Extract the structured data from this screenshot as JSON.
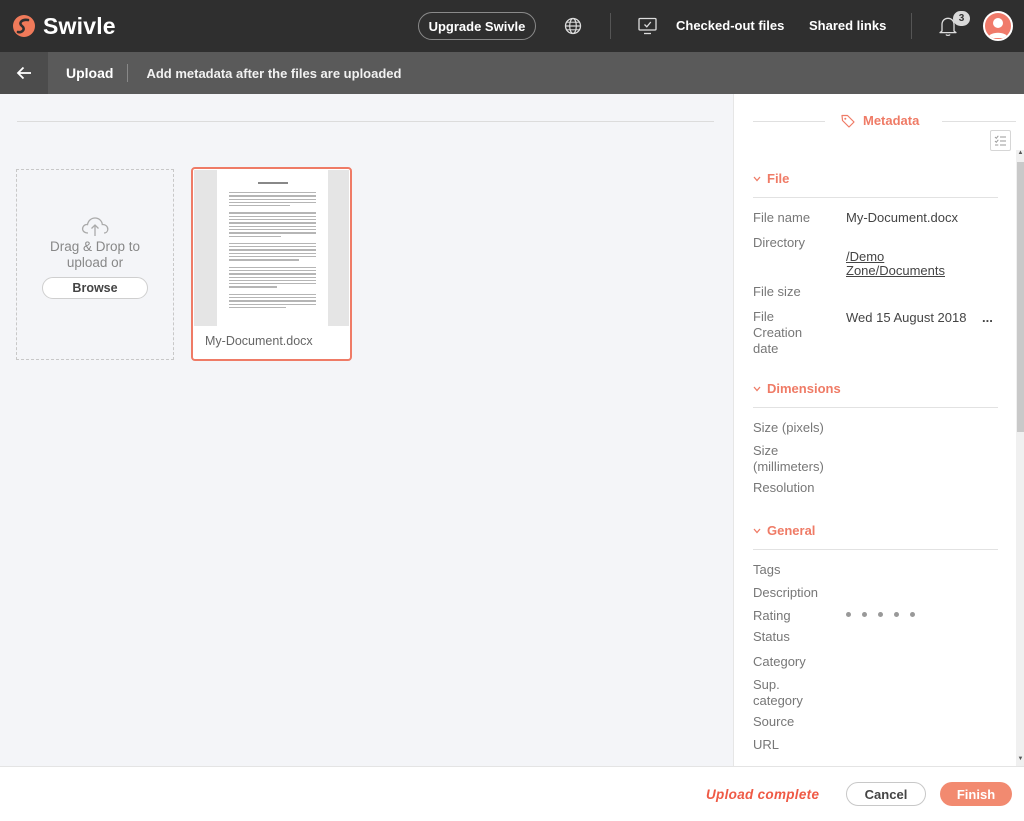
{
  "app": {
    "name": "Swivle"
  },
  "topbar": {
    "upgrade_label": "Upgrade Swivle",
    "checked_out_label": "Checked-out files",
    "shared_links_label": "Shared links",
    "notification_count": "3"
  },
  "subbar": {
    "title": "Upload",
    "description": "Add metadata after the files are uploaded"
  },
  "dropzone": {
    "text": "Drag & Drop to upload or",
    "browse_label": "Browse"
  },
  "file": {
    "name": "My-Document.docx"
  },
  "panel": {
    "heading": "Metadata",
    "sections": {
      "file": {
        "title": "File",
        "file_name_label": "File name",
        "file_name_value": "My-Document.docx",
        "directory_label": "Directory",
        "directory_value_1": "/Demo ",
        "directory_value_2": "Zone/Documents",
        "file_size_label": "File size",
        "creation_label_1": "File",
        "creation_label_2": "Creation",
        "creation_label_3": "date",
        "creation_value": "Wed 15 August 2018",
        "creation_more": "..."
      },
      "dimensions": {
        "title": "Dimensions",
        "size_px_label": "Size (pixels)",
        "size_mm_label_1": "Size",
        "size_mm_label_2": "(millimeters)",
        "resolution_label": "Resolution"
      },
      "general": {
        "title": "General",
        "tags_label": "Tags",
        "description_label": "Description",
        "rating_label": "Rating",
        "rating_value": 0,
        "rating_max": 5,
        "status_label": "Status",
        "category_label": "Category",
        "sup_category_label_1": "Sup.",
        "sup_category_label_2": "category",
        "source_label": "Source",
        "url_label": "URL"
      }
    }
  },
  "footer": {
    "status": "Upload complete",
    "cancel_label": "Cancel",
    "finish_label": "Finish"
  },
  "colors": {
    "accent": "#ef7b66",
    "topbar": "#2f2f2f",
    "subbar": "#5a5a5a",
    "finish": "#f28a70"
  }
}
